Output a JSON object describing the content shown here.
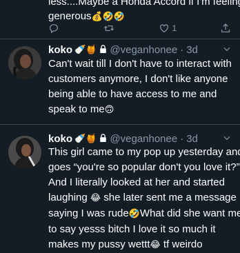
{
  "top_tweet": {
    "lines": [
      "less....Maybe a Honda Accord if I'm feeling",
      "generous"
    ],
    "emojis": "💰🤣🤣",
    "like_count": "1"
  },
  "tweets": [
    {
      "name": "koko",
      "name_emojis": "🍼🍯",
      "handle": "@veganhonee",
      "time": "3d",
      "lines": [
        "Can't wait till I don't have to interact with",
        "customers anymore, I don't like anyone",
        "being able to have access to me and",
        "speak to me"
      ],
      "end_emoji": "🙃"
    },
    {
      "name": "koko",
      "name_emojis": "🍼🍯",
      "handle": "@veganhonee",
      "time": "3d",
      "segments": [
        {
          "text": "This girl came to my pop up yesterday and"
        },
        {
          "text": "goes “you're so popular don't you love it?”"
        },
        {
          "text": "And I literally looked at her and started"
        },
        {
          "text": "laughing ",
          "emoji": "😂",
          "after": " she later sent me a message"
        },
        {
          "text": "saying I was rude",
          "emoji": "🤣",
          "after": "What did she want me"
        },
        {
          "text": "to say yesss bitch I love it so much it"
        },
        {
          "text": "makes my pussy wettt",
          "emoji": "😂",
          "after": " tf weirdo"
        }
      ]
    }
  ],
  "icons": {
    "reply": "reply-icon",
    "retweet": "retweet-icon",
    "like": "heart-icon",
    "share": "share-icon",
    "lock": "lock-icon",
    "more": "chevron-down-icon"
  },
  "colors": {
    "background": "#141d26",
    "secondary_text": "#8899a6",
    "divider": "#38444d"
  }
}
